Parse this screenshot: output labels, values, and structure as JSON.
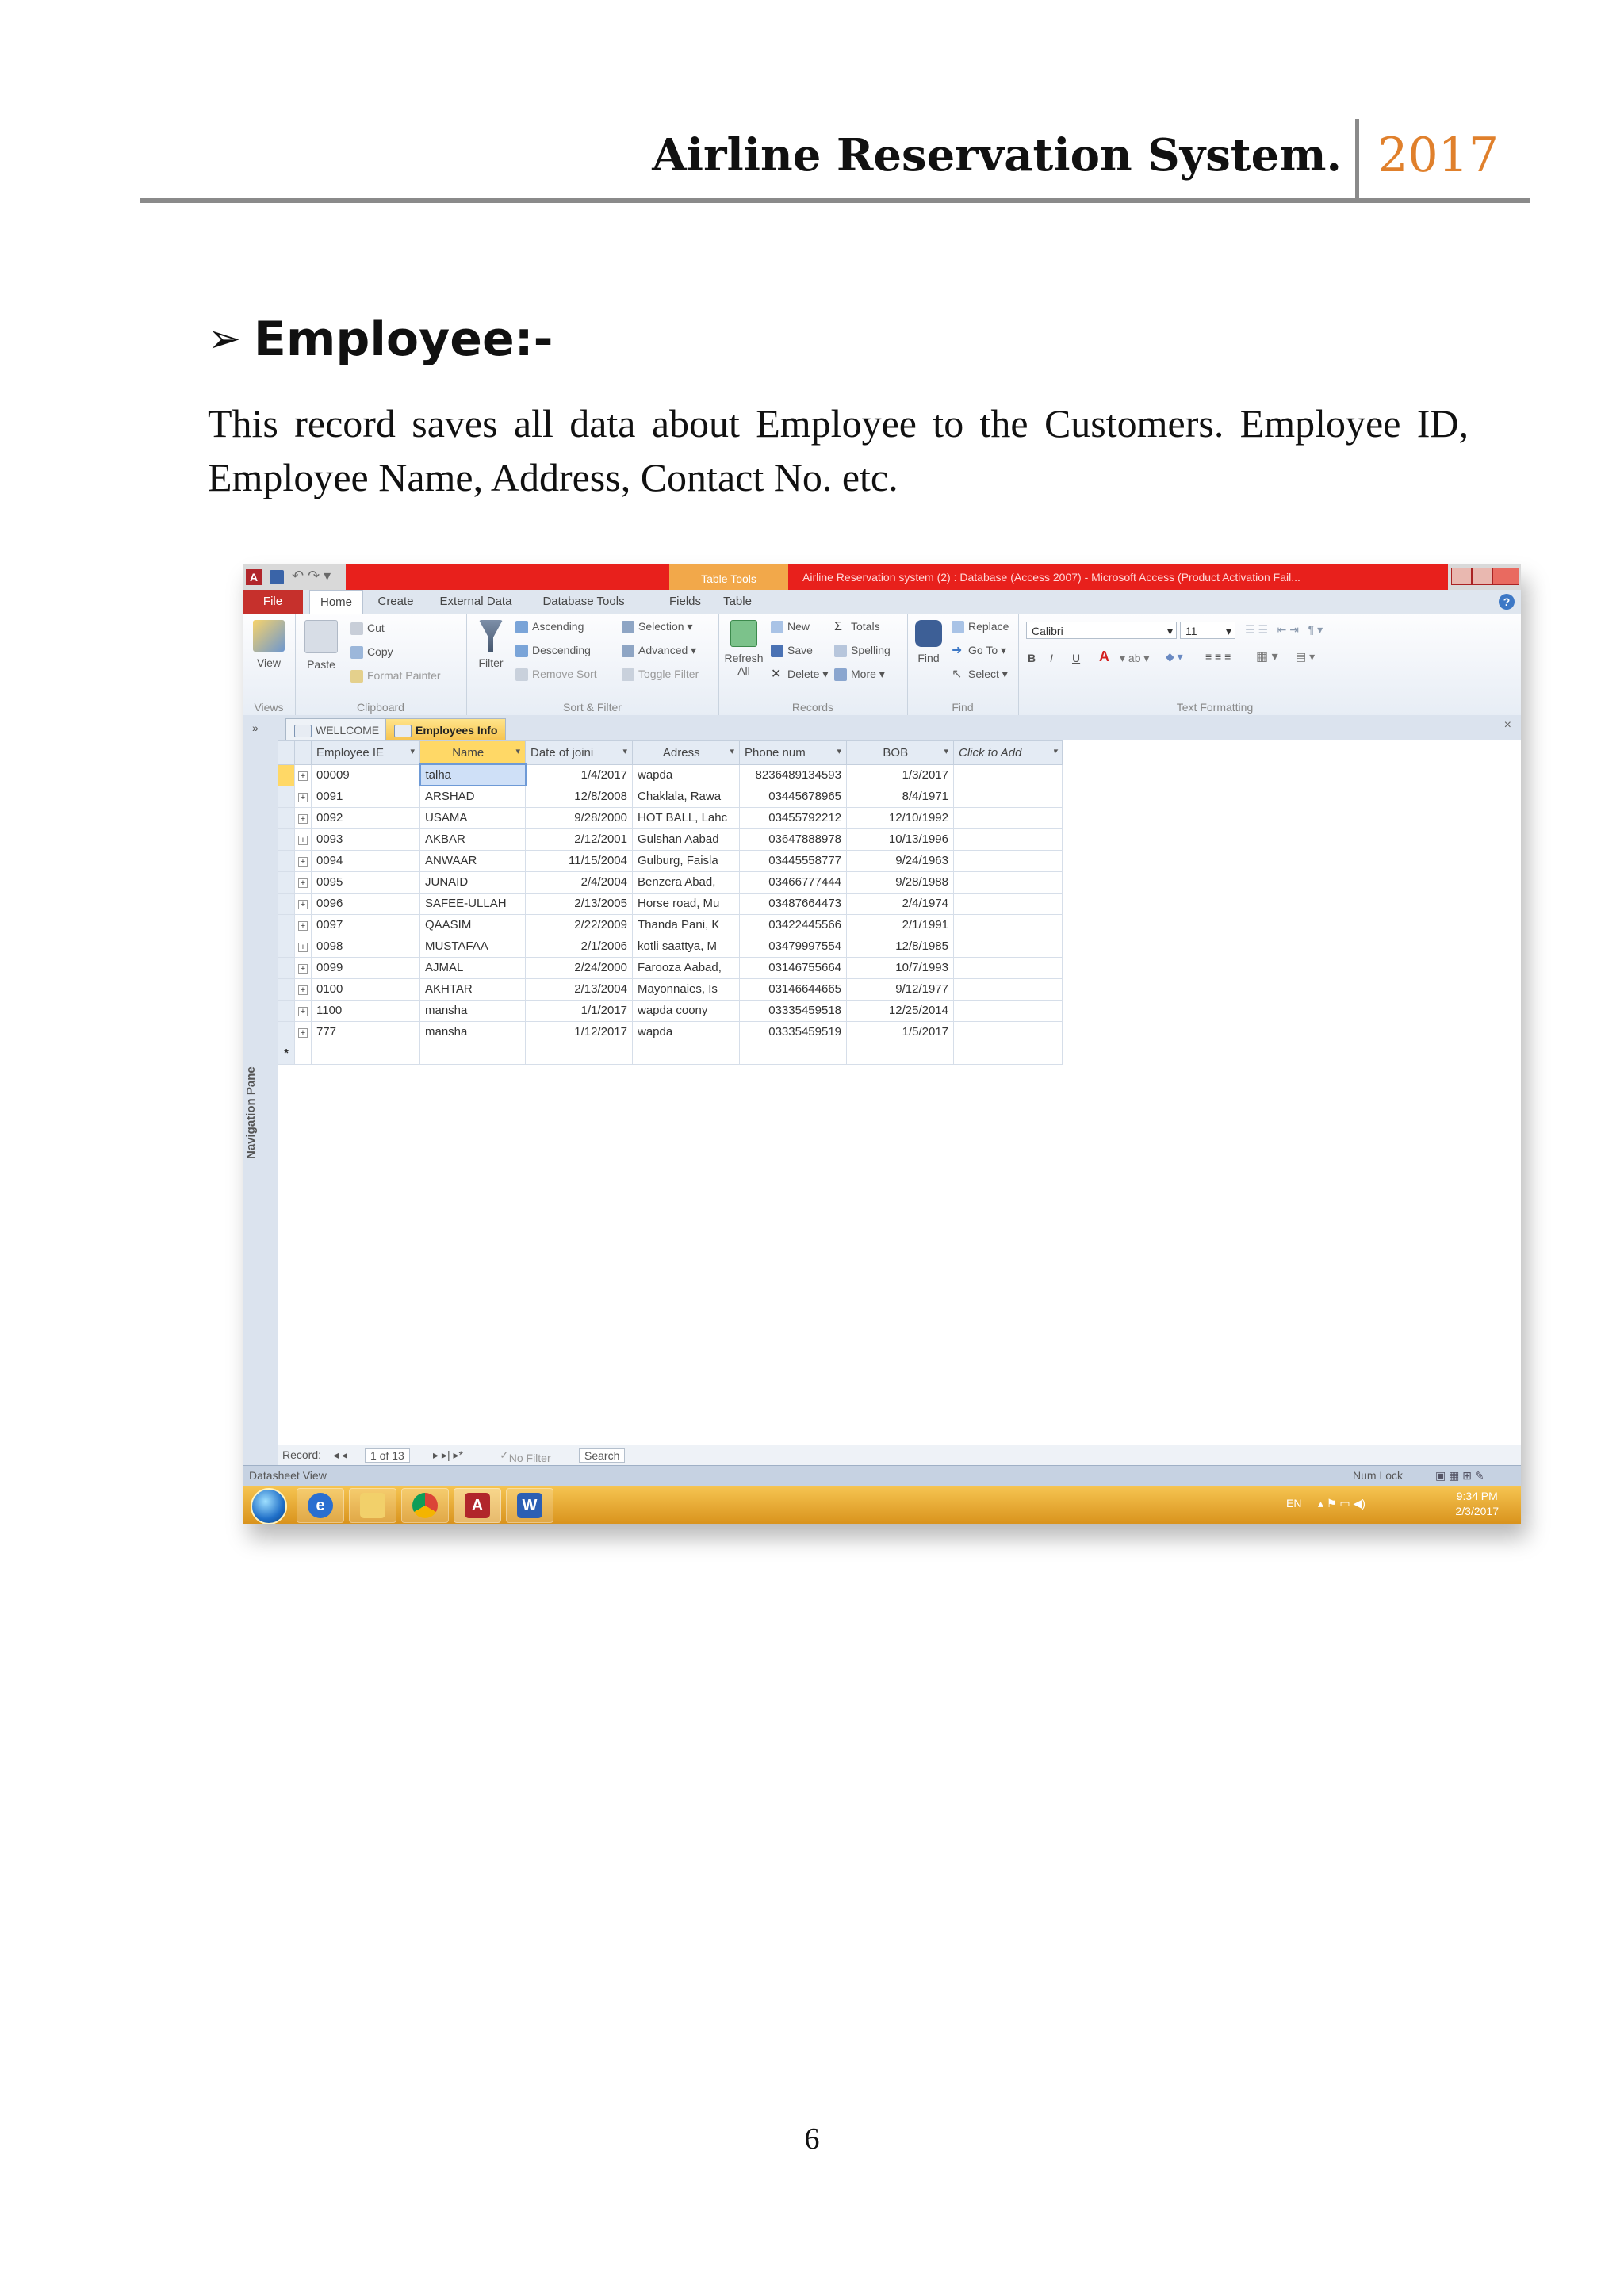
{
  "header": {
    "title": "Airline Reservation System.",
    "year": "2017"
  },
  "section": {
    "heading": "Employee:-",
    "body": "This record saves all data about Employee to the Customers. Employee ID, Employee Name, Address, Contact No. etc."
  },
  "screenshot": {
    "titlebar": {
      "app_icon": "A",
      "contextual_tab": "Table Tools",
      "title": "Airline Reservation system (2) : Database (Access 2007) - Microsoft Access (Product Activation Fail..."
    },
    "tabs": [
      "File",
      "Home",
      "Create",
      "External Data",
      "Database Tools",
      "Fields",
      "Table"
    ],
    "ribbon": {
      "views": {
        "label": "Views",
        "view": "View"
      },
      "clipboard": {
        "label": "Clipboard",
        "paste": "Paste",
        "cut": "Cut",
        "copy": "Copy",
        "format_painter": "Format Painter"
      },
      "sort_filter": {
        "label": "Sort & Filter",
        "filter": "Filter",
        "ascending": "Ascending",
        "descending": "Descending",
        "remove_sort": "Remove Sort",
        "selection": "Selection",
        "advanced": "Advanced",
        "toggle_filter": "Toggle Filter"
      },
      "records": {
        "label": "Records",
        "refresh": "Refresh All",
        "new": "New",
        "save": "Save",
        "delete": "Delete",
        "totals": "Totals",
        "spelling": "Spelling",
        "more": "More"
      },
      "find": {
        "label": "Find",
        "find": "Find",
        "replace": "Replace",
        "goto": "Go To",
        "select": "Select"
      },
      "text_formatting": {
        "label": "Text Formatting",
        "font": "Calibri",
        "size": "11",
        "bold": "B",
        "italic": "I",
        "underline": "U"
      }
    },
    "nav_pane_label": "Navigation Pane",
    "doc_tabs": [
      "WELLCOME",
      "Employees Info"
    ],
    "grid": {
      "columns": [
        "Employee IE",
        "Name",
        "Date of joini",
        "Adress",
        "Phone num",
        "BOB",
        "Click to Add"
      ],
      "rows": [
        [
          "00009",
          "talha",
          "1/4/2017",
          "wapda",
          "8236489134593",
          "1/3/2017"
        ],
        [
          "0091",
          "ARSHAD",
          "12/8/2008",
          "Chaklala, Rawa",
          "03445678965",
          "8/4/1971"
        ],
        [
          "0092",
          "USAMA",
          "9/28/2000",
          "HOT BALL, Lahc",
          "03455792212",
          "12/10/1992"
        ],
        [
          "0093",
          "AKBAR",
          "2/12/2001",
          "Gulshan Aabad",
          "03647888978",
          "10/13/1996"
        ],
        [
          "0094",
          "ANWAAR",
          "11/15/2004",
          "Gulburg, Faisla",
          "03445558777",
          "9/24/1963"
        ],
        [
          "0095",
          "JUNAID",
          "2/4/2004",
          "Benzera Abad,",
          "03466777444",
          "9/28/1988"
        ],
        [
          "0096",
          "SAFEE-ULLAH",
          "2/13/2005",
          "Horse road, Mu",
          "03487664473",
          "2/4/1974"
        ],
        [
          "0097",
          "QAASIM",
          "2/22/2009",
          "Thanda Pani, K",
          "03422445566",
          "2/1/1991"
        ],
        [
          "0098",
          "MUSTAFAA",
          "2/1/2006",
          "kotli saattya, M",
          "03479997554",
          "12/8/1985"
        ],
        [
          "0099",
          "AJMAL",
          "2/24/2000",
          "Farooza Aabad,",
          "03146755664",
          "10/7/1993"
        ],
        [
          "0100",
          "AKHTAR",
          "2/13/2004",
          "Mayonnaies, Is",
          "03146644665",
          "9/12/1977"
        ],
        [
          "1100",
          "mansha",
          "1/1/2017",
          "wapda coony",
          "03335459518",
          "12/25/2014"
        ],
        [
          "777",
          "mansha",
          "1/12/2017",
          "wapda",
          "03335459519",
          "1/5/2017"
        ]
      ],
      "new_row_marker": "*"
    },
    "record_nav": {
      "label": "Record:",
      "position": "1 of 13",
      "filter": "No Filter",
      "search": "Search"
    },
    "status": {
      "left": "Datasheet View",
      "right": "Num Lock"
    },
    "taskbar": {
      "lang": "EN",
      "time": "9:34 PM",
      "date": "2/3/2017"
    },
    "colors": {
      "title_red": "#e8201c",
      "file_tab": "#c6302c",
      "selected_header": "#ffd866",
      "taskbar": "#e2a33a"
    }
  },
  "page_number": "6"
}
